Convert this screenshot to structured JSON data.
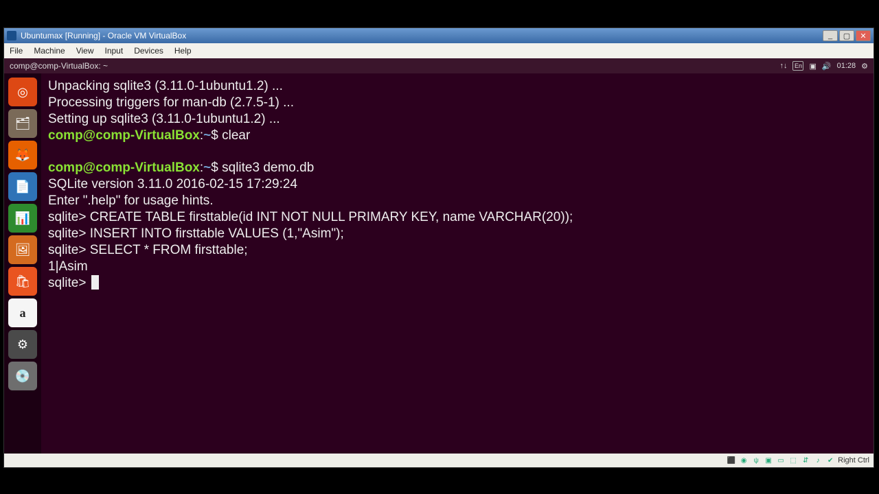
{
  "titlebar": {
    "text": "Ubuntumax [Running] - Oracle VM VirtualBox"
  },
  "menubar": [
    "File",
    "Machine",
    "View",
    "Input",
    "Devices",
    "Help"
  ],
  "topbar": {
    "path": "comp@comp-VirtualBox: ~",
    "lang": "En",
    "time": "01:28"
  },
  "launcher": [
    {
      "name": "ubuntu-dash",
      "bg": "#dd4814",
      "glyph": "◎"
    },
    {
      "name": "files",
      "bg": "#7a6a58",
      "glyph": "🗂"
    },
    {
      "name": "firefox",
      "bg": "#e66000",
      "glyph": "🦊"
    },
    {
      "name": "writer",
      "bg": "#2f73b7",
      "glyph": "📄"
    },
    {
      "name": "calc",
      "bg": "#2e8b2e",
      "glyph": "📊"
    },
    {
      "name": "impress",
      "bg": "#d46b1f",
      "glyph": "🖼"
    },
    {
      "name": "software",
      "bg": "#e95420",
      "glyph": "🛍"
    },
    {
      "name": "amazon",
      "bg": "#f5f5f5",
      "glyph": "a"
    },
    {
      "name": "settings",
      "bg": "#4a4a4a",
      "glyph": "⚙"
    },
    {
      "name": "disc",
      "bg": "#6e6e6e",
      "glyph": "💿"
    }
  ],
  "term": {
    "l1": "Unpacking sqlite3 (3.11.0-1ubuntu1.2) ...",
    "l2": "Processing triggers for man-db (2.7.5-1) ...",
    "l3": "Setting up sqlite3 (3.11.0-1ubuntu1.2) ...",
    "user": "comp@comp-VirtualBox",
    "sep": ":",
    "path": "~",
    "dollar": "$ ",
    "cmd_clear": "clear",
    "cmd_sqlite": "sqlite3 demo.db",
    "l4": "SQLite version 3.11.0 2016-02-15 17:29:24",
    "l5": "Enter \".help\" for usage hints.",
    "sq": "sqlite> ",
    "s1": "CREATE TABLE firsttable(id INT NOT NULL PRIMARY KEY, name VARCHAR(20));",
    "s2": "INSERT INTO firsttable VALUES (1,\"Asim\");",
    "s3": "SELECT * FROM firsttable;",
    "r1": "1|Asim"
  },
  "statusbar": {
    "hostkey": "Right Ctrl"
  }
}
